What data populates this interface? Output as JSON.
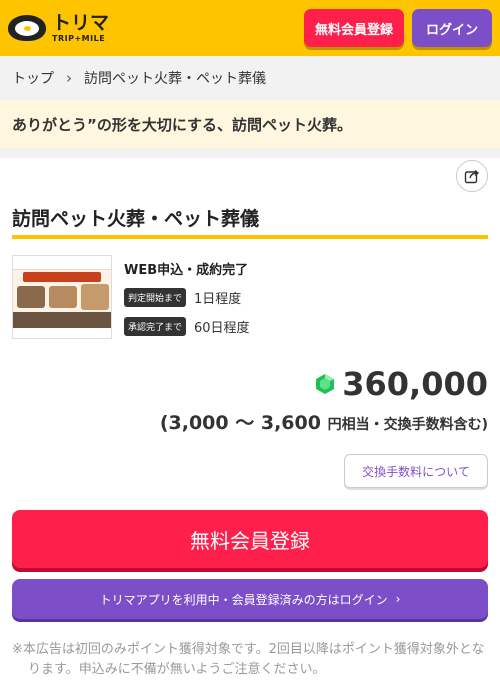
{
  "header": {
    "logo_text": "トリマ",
    "logo_sub": "TRIP+MILE",
    "register_label": "無料会員登録",
    "login_label": "ログイン"
  },
  "breadcrumb": {
    "home": "トップ",
    "current": "訪問ペット火葬・ペット葬儀"
  },
  "tagline": "ありがとう”の形を大切にする、訪問ペット火葬。",
  "offer": {
    "title": "訪問ペット火葬・ペット葬儀",
    "status": "WEB申込・成約完了",
    "judge_badge": "判定開始まで",
    "judge_value": "1日程度",
    "approve_badge": "承認完了まで",
    "approve_value": "60日程度",
    "points": "360,000",
    "yen_text": "(3,000 〜 3,600",
    "yen_suffix": "円相当・交換手数料含む)",
    "fee_label": "交換手数料について"
  },
  "actions": {
    "register_label": "無料会員登録",
    "login_label": "トリマアプリを利用中・会員登録済みの方はログイン"
  },
  "note": "※本広告は初回のみポイント獲得対象です。2回目以降はポイント獲得対象外となります。申込みに不備が無いようご注意ください。",
  "colors": {
    "header": "#ffc400",
    "register": "#ff1f4b",
    "login": "#7c4fc9"
  }
}
